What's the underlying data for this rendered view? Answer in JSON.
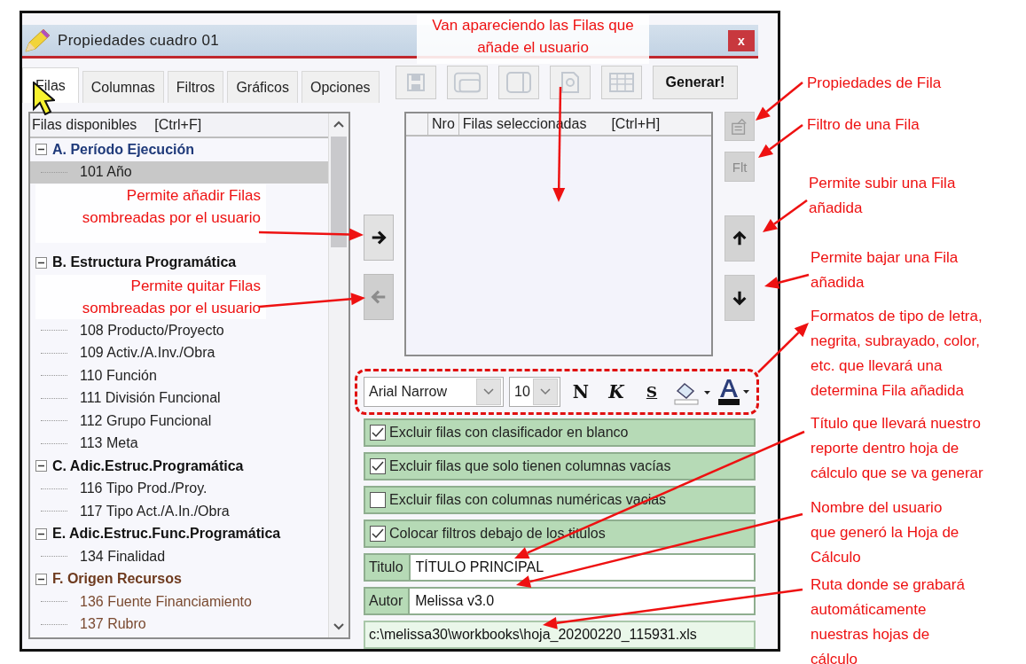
{
  "window": {
    "title": "Propiedades cuadro 01",
    "close": "x"
  },
  "tabs": [
    {
      "label": "Filas",
      "selected": true
    },
    {
      "label": "Columnas",
      "selected": false
    },
    {
      "label": "Filtros",
      "selected": false
    },
    {
      "label": "Gráficos",
      "selected": false
    },
    {
      "label": "Opciones",
      "selected": false
    }
  ],
  "toolbar": {
    "buttons": [
      {
        "kind": "save",
        "disabled": true
      },
      {
        "kind": "window",
        "disabled": true
      },
      {
        "kind": "panel",
        "disabled": true
      },
      {
        "kind": "search",
        "disabled": true
      },
      {
        "kind": "grid",
        "disabled": true
      }
    ],
    "generate": "Generar!"
  },
  "available_rows": {
    "header": "Filas disponibles",
    "shortcut": "[Ctrl+F]",
    "groups": [
      {
        "label": "A. Período Ejecución",
        "color": "#1f3a7a",
        "expanded": true,
        "children": [
          {
            "label": "101 Año",
            "selected": true,
            "color": "#222222"
          }
        ]
      },
      {
        "label": "B. Estructura Programática",
        "color": "#111111",
        "expanded": true,
        "children": [
          {
            "label": "108 Producto/Proyecto",
            "selected": false,
            "color": "#222222"
          },
          {
            "label": "109 Activ./A.Inv./Obra",
            "selected": false,
            "color": "#222222"
          },
          {
            "label": "110 Función",
            "selected": false,
            "color": "#222222"
          },
          {
            "label": "111 División Funcional",
            "selected": false,
            "color": "#222222"
          },
          {
            "label": "112 Grupo Funcional",
            "selected": false,
            "color": "#222222"
          },
          {
            "label": "113 Meta",
            "selected": false,
            "color": "#222222"
          }
        ]
      },
      {
        "label": "C. Adic.Estruc.Programática",
        "color": "#111111",
        "expanded": true,
        "children": [
          {
            "label": "116 Tipo Prod./Proy.",
            "selected": false,
            "color": "#222222"
          },
          {
            "label": "117 Tipo Act./A.In./Obra",
            "selected": false,
            "color": "#222222"
          }
        ]
      },
      {
        "label": "E. Adic.Estruc.Func.Programática",
        "color": "#111111",
        "expanded": true,
        "children": [
          {
            "label": "134 Finalidad",
            "selected": false,
            "color": "#222222"
          }
        ]
      },
      {
        "label": "F. Origen Recursos",
        "color": "#6e3a1e",
        "expanded": true,
        "children": [
          {
            "label": "136 Fuente Financiamiento",
            "selected": false,
            "color": "#7a4a30"
          },
          {
            "label": "137 Rubro",
            "selected": false,
            "color": "#7a4a30"
          }
        ]
      }
    ]
  },
  "move_buttons": [
    {
      "kind": "add",
      "disabled": false
    },
    {
      "kind": "remove",
      "disabled": true
    }
  ],
  "selected_rows": {
    "columns": [
      "Nro",
      "Filas seleccionadas"
    ],
    "shortcut": "[Ctrl+H]"
  },
  "side_buttons": [
    {
      "kind": "properties",
      "disabled": true
    },
    {
      "kind": "filter",
      "label": "Flt",
      "disabled": true
    },
    {
      "kind": "up",
      "disabled": false
    },
    {
      "kind": "down",
      "disabled": false
    }
  ],
  "format": {
    "font": "Arial Narrow",
    "size": "10",
    "styles": [
      {
        "kind": "bold",
        "label": "N"
      },
      {
        "kind": "italic",
        "label": "K"
      },
      {
        "kind": "underline",
        "label": "S"
      }
    ]
  },
  "options": [
    {
      "label": "Excluir filas con clasificador en blanco",
      "checked": true
    },
    {
      "label": "Excluir filas que solo tienen columnas vacías",
      "checked": true
    },
    {
      "label": "Excluir filas con columnas numéricas vacias",
      "checked": false
    },
    {
      "label": "Colocar filtros debajo de los titulos",
      "checked": true
    }
  ],
  "fields": [
    {
      "label": "Titulo",
      "value": "TÍTULO PRINCIPAL"
    },
    {
      "label": "Autor",
      "value": "Melissa v3.0"
    }
  ],
  "path": "c:\\melissa30\\workbooks\\hoja_20200220_115931.xls",
  "annotations": [
    "Van apareciendo las Filas que\nañade el usuario",
    "Permite añadir Filas\nsombreadas por el usuario",
    "Permite quitar Filas\nsombreadas por el usuario",
    "Propiedades de Fila",
    "Filtro de una Fila",
    "Permite subir una Fila\nañadida",
    "Permite bajar una Fila\nañadida",
    "Formatos de tipo de letra,\nnegrita, subrayado, color,\netc. que llevará una\ndetermina Fila añadida",
    "Título que llevará nuestro\nreporte dentro hoja de\ncálculo que se va generar",
    "Nombre del usuario\nque generó la Hoja de\nCálculo",
    "Ruta donde se grabará\nautomáticamente\nnuestras hojas de\ncálculo"
  ]
}
